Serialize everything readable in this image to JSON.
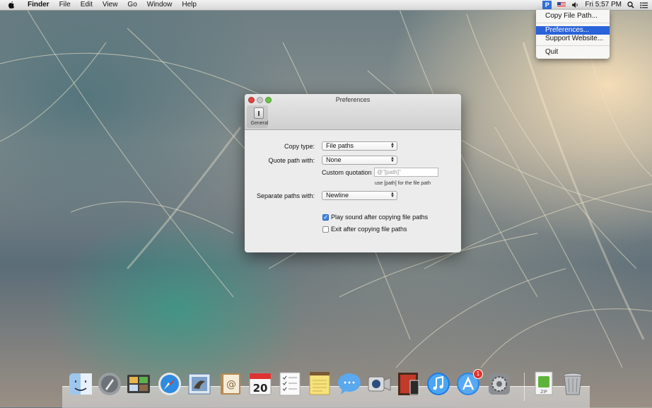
{
  "menubar": {
    "app_name": "Finder",
    "menus": [
      "File",
      "Edit",
      "View",
      "Go",
      "Window",
      "Help"
    ],
    "status_app_letter": "P",
    "clock": "Fri 5:57 PM"
  },
  "status_menu": {
    "items": [
      "Copy File Path...",
      "Preferences...",
      "Support Website...",
      "Quit"
    ],
    "selected": "Preferences..."
  },
  "window": {
    "title": "Preferences",
    "toolbar_tab": "General",
    "copy_type_label": "Copy type:",
    "copy_type_value": "File paths",
    "quote_label": "Quote path with:",
    "quote_value": "None",
    "custom_quotation_label": "Custom quotation",
    "custom_quotation_placeholder": "@\"[path]\"",
    "custom_hint": "use [path] for the file path",
    "separate_label": "Separate paths with:",
    "separate_value": "Newline",
    "play_sound_label": "Play sound after copying file paths",
    "play_sound_checked": true,
    "exit_label": "Exit after copying file paths",
    "exit_checked": false
  },
  "dock": {
    "apps": [
      "Finder",
      "Launchpad",
      "Photo Booth",
      "Safari",
      "Mail",
      "Contacts",
      "Calendar",
      "Reminders",
      "Notes",
      "Messages",
      "FaceTime",
      "Photo Browser",
      "iTunes",
      "App Store",
      "System Preferences",
      "Archive",
      "Trash"
    ],
    "calendar_day": "20",
    "app_store_badge": "1",
    "archive_label": "ZIP"
  }
}
